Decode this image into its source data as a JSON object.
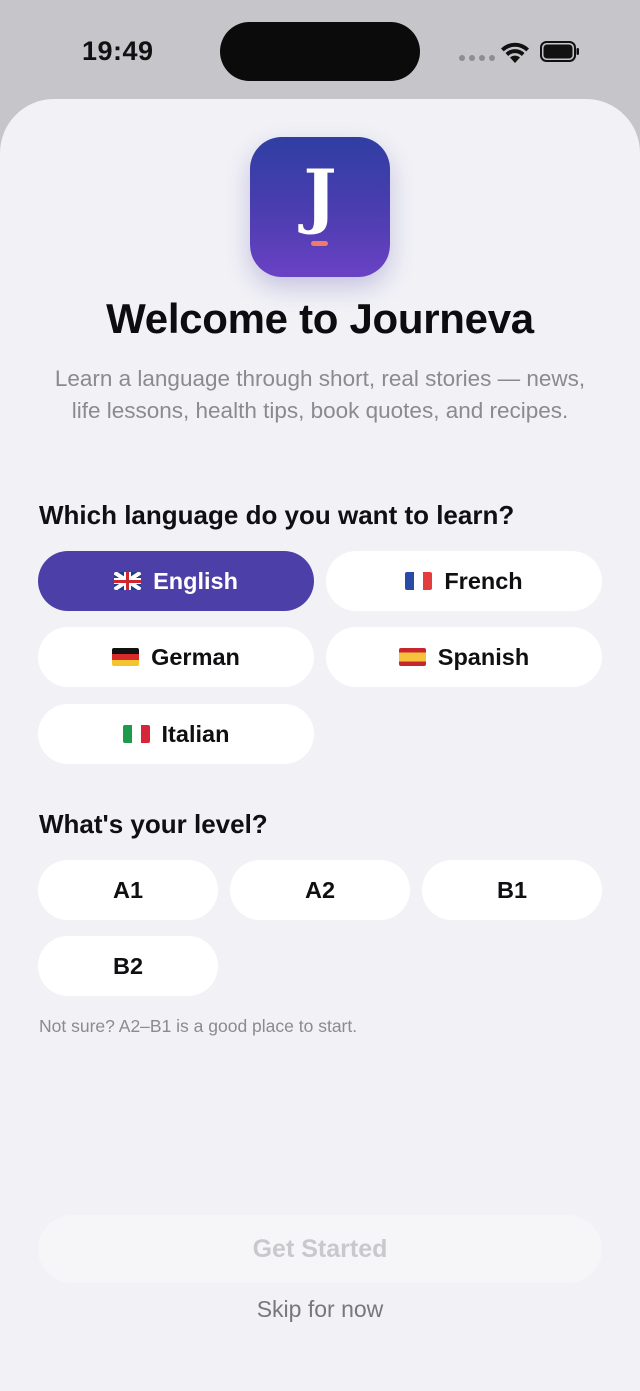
{
  "status_bar": {
    "time": "19:49"
  },
  "app": {
    "icon_letter": "J",
    "title": "Welcome to Journeva",
    "subtitle": "Learn a language through short, real stories — news, life lessons, health tips, book quotes, and recipes."
  },
  "language_section": {
    "label": "Which language do you want to learn?",
    "options": [
      {
        "label": "English",
        "flag": "uk-flag",
        "selected": true
      },
      {
        "label": "French",
        "flag": "france-flag",
        "selected": false
      },
      {
        "label": "German",
        "flag": "germany-flag",
        "selected": false
      },
      {
        "label": "Spanish",
        "flag": "spain-flag",
        "selected": false
      },
      {
        "label": "Italian",
        "flag": "italy-flag",
        "selected": false
      }
    ]
  },
  "level_section": {
    "label": "What's your level?",
    "options": [
      {
        "label": "A1",
        "selected": false
      },
      {
        "label": "A2",
        "selected": false
      },
      {
        "label": "B1",
        "selected": false
      },
      {
        "label": "B2",
        "selected": false
      }
    ],
    "hint": "Not sure? A2–B1 is a good place to start."
  },
  "actions": {
    "primary_label": "Get Started",
    "primary_enabled": false,
    "secondary_label": "Skip for now"
  },
  "colors": {
    "accent": "#4c3fa8",
    "background": "#f1f1f6",
    "pill_background": "#ffffff",
    "secondary_text": "#8a8a8f"
  }
}
